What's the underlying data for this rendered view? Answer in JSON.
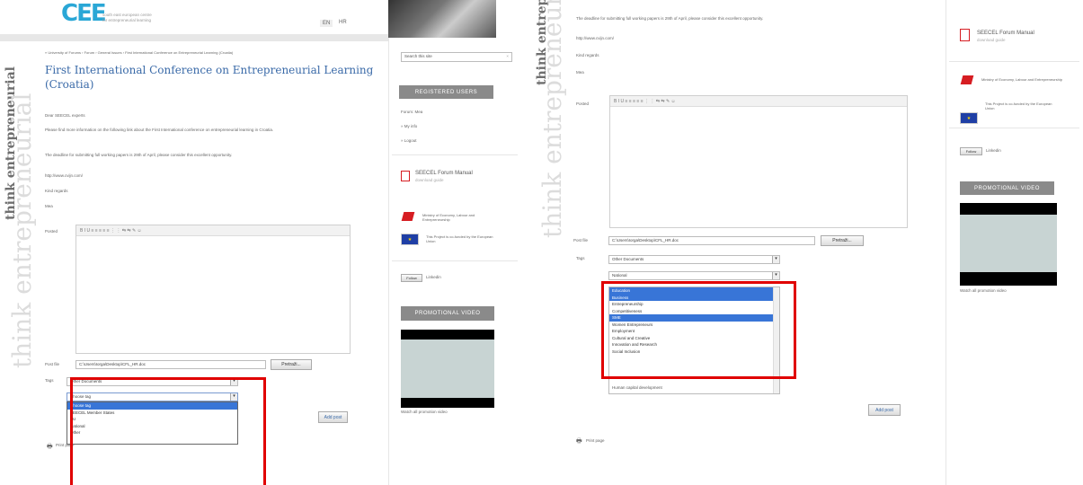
{
  "header": {
    "logo": "CEE",
    "tagline": "south east european centre for entrepreneurial learning",
    "lang_en": "EN",
    "lang_hr": "HR"
  },
  "sidebar_text": {
    "dark": "think entrepreneurial",
    "light": "think entrepreneurial"
  },
  "breadcrumb": "» University of Forums  ›  Forum  ›  General Issues  ›  First International Conference on Entrepreneurial Learning (Croatia)",
  "post": {
    "title": "First International Conference on Entrepreneurial Learning (Croatia)",
    "greeting": "Dear SEECEL experts",
    "body1": "Please find more information on the following link about the First International conference on entrepreneurial learning in Croatia.",
    "body2": "The deadline for submitting full working papers is 29th of April, please consider this excellent opportunity.",
    "link": "http://www.cvijn.com/",
    "closing": "Kind regards",
    "signature": "Mea"
  },
  "form": {
    "posted_label": "Posted",
    "toolbar": "B I U ≡ ≡ ≡ ≡ ≡ ⋮ ⋮ ⇆ ⇆ ✎ ☺",
    "file_label": "Post file",
    "file_value": "C:\\Users\\Iorga\\Desktop\\CFL_HR.doc",
    "browse_btn": "Pretraži...",
    "tags_label": "Tags",
    "tags_select1": "Other Documents",
    "tags_select2_left": "Choose tag",
    "tags_select2_right": "National",
    "submit_btn": "Add post",
    "print": "Print page"
  },
  "left_dropdown_options": [
    {
      "label": "Choose tag",
      "selected": true
    },
    {
      "label": "SEECEL Member States",
      "selected": false
    },
    {
      "label": "EU",
      "selected": false
    },
    {
      "label": "National",
      "selected": false
    },
    {
      "label": "Other",
      "selected": false
    }
  ],
  "right_listbox_options": [
    {
      "label": "Education",
      "selected": true
    },
    {
      "label": "Business",
      "selected": true
    },
    {
      "label": "Entrepreneurship",
      "selected": false
    },
    {
      "label": "Competitiveness",
      "selected": false
    },
    {
      "label": "SME",
      "selected": true
    },
    {
      "label": "Women Entrepreneurs",
      "selected": false
    },
    {
      "label": "Employment",
      "selected": false
    },
    {
      "label": "Cultural and Creative",
      "selected": false
    },
    {
      "label": "Innovation and Research",
      "selected": false
    },
    {
      "label": "Social Inclusion",
      "selected": false
    }
  ],
  "right_listbox_extra": "Human capital development",
  "sidebar": {
    "search_placeholder": "Search this site",
    "registered_users": "REGISTERED USERS",
    "user_label": "Forum: Mea",
    "my_info": "» My info",
    "logout": "» Logout",
    "manual_title": "SEECEL Forum Manual",
    "manual_sub": "download guide",
    "ministry": "Ministry of Economy, Labour and Entrepreneurship",
    "eu_text": "This Project is co-funded by the European Union",
    "follow": "Follow",
    "linkedin": "Linkedin",
    "promo_video": "PROMOTIONAL VIDEO",
    "watch": "Watch all promotion video"
  },
  "colors": {
    "accent_blue": "#3a6aa8",
    "highlight_red": "#e00000",
    "select_blue": "#3875d7",
    "logo_blue": "#2aa7d6"
  }
}
